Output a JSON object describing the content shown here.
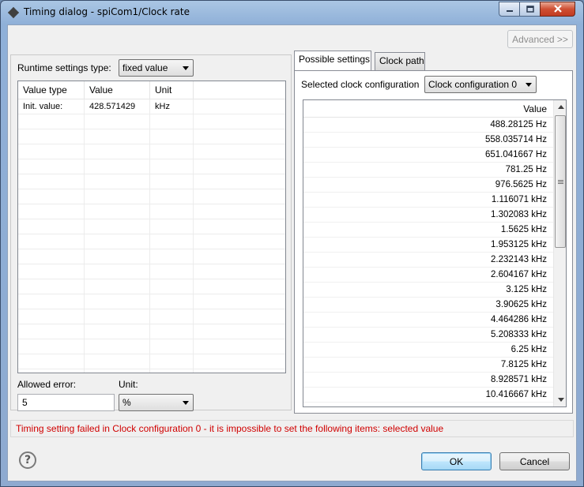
{
  "window": {
    "title": "Timing dialog - spiCom1/Clock rate"
  },
  "toolbar": {
    "advanced_label": "Advanced >>"
  },
  "runtime": {
    "type_label": "Runtime settings type:",
    "type_value": "fixed value",
    "table": {
      "headers": [
        "Value type",
        "Value",
        "Unit"
      ],
      "rows": [
        [
          "Init. value:",
          "428.571429",
          "kHz"
        ]
      ]
    },
    "allowed_error_label": "Allowed error:",
    "allowed_error_value": "5",
    "unit_label": "Unit:",
    "unit_value": "%"
  },
  "tabs": [
    {
      "label": "Possible settings",
      "active": true
    },
    {
      "label": "Clock path",
      "active": false
    }
  ],
  "possible_settings": {
    "config_label": "Selected clock configuration",
    "config_value": "Clock configuration 0",
    "list_header": "Value",
    "values": [
      "488.28125 Hz",
      "558.035714 Hz",
      "651.041667 Hz",
      "781.25 Hz",
      "976.5625 Hz",
      "1.116071 kHz",
      "1.302083 kHz",
      "1.5625 kHz",
      "1.953125 kHz",
      "2.232143 kHz",
      "2.604167 kHz",
      "3.125 kHz",
      "3.90625 kHz",
      "4.464286 kHz",
      "5.208333 kHz",
      "6.25 kHz",
      "7.8125 kHz",
      "8.928571 kHz",
      "10.416667 kHz"
    ]
  },
  "status": {
    "message": "Timing setting failed in Clock configuration 0 - it is impossible to set the following items: selected value",
    "color": "#d00000"
  },
  "buttons": {
    "help": "?",
    "ok": "OK",
    "cancel": "Cancel"
  }
}
